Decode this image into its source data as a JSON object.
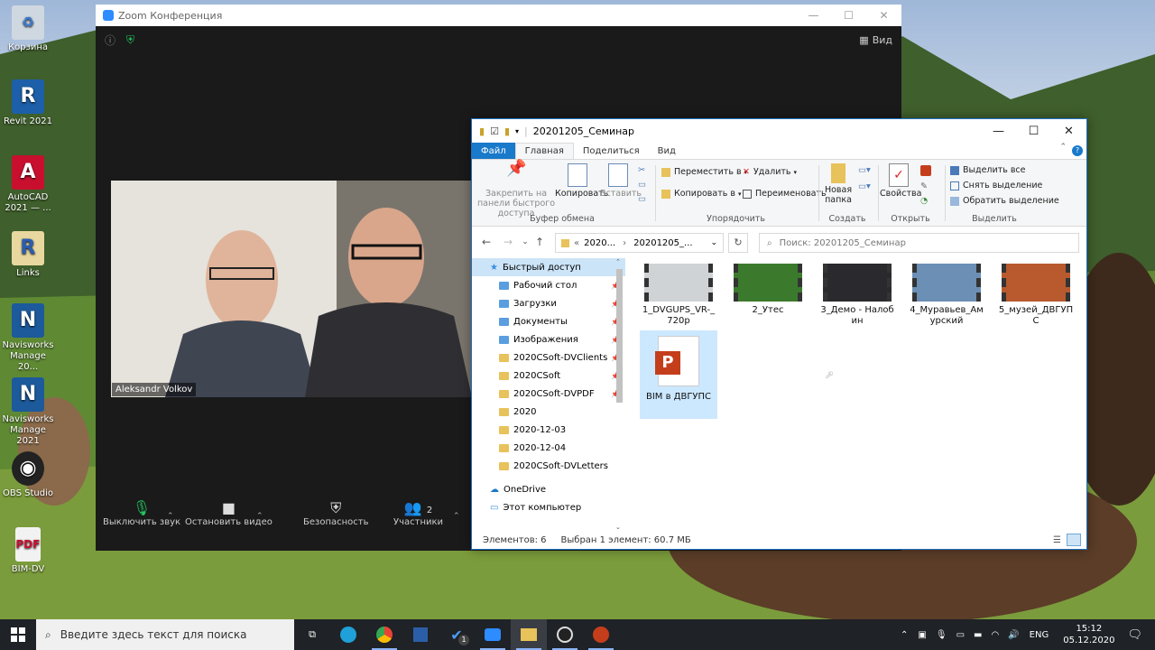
{
  "desktop": {
    "icons": [
      {
        "label": "Корзина",
        "icon": "recycle-bin-icon"
      },
      {
        "label": "Revit 2021",
        "icon": "revit-icon"
      },
      {
        "label": "AutoCAD 2021 — ...",
        "icon": "autocad-icon"
      },
      {
        "label": "Links",
        "icon": "links-icon"
      },
      {
        "label": "Navisworks Manage 20...",
        "icon": "navisworks-icon"
      },
      {
        "label": "Navisworks Manage 2021",
        "icon": "navisworks-icon"
      },
      {
        "label": "OBS Studio",
        "icon": "obs-icon"
      },
      {
        "label": "BIM-DV",
        "icon": "pdf-icon"
      }
    ]
  },
  "zoom": {
    "title": "Zoom Конференция",
    "view_label": "Вид",
    "participant_name": "Aleksandr Volkov",
    "controls": {
      "mute": "Выключить звук",
      "video": "Остановить видео",
      "security": "Безопасность",
      "participants": "Участники",
      "participants_count": "2"
    }
  },
  "explorer": {
    "title": "20201205_Семинар",
    "tabs": [
      "Файл",
      "Главная",
      "Поделиться",
      "Вид"
    ],
    "ribbon": {
      "pin": "Закрепить на панели быстрого доступа",
      "copy": "Копировать",
      "paste": "Вставить",
      "clipboard_group": "Буфер обмена",
      "move_to": "Переместить в",
      "copy_to": "Копировать в",
      "delete": "Удалить",
      "rename": "Переименовать",
      "organize_group": "Упорядочить",
      "new_folder": "Новая папка",
      "create_group": "Создать",
      "properties": "Свойства",
      "open_group": "Открыть",
      "select_all": "Выделить все",
      "select_none": "Снять выделение",
      "invert": "Обратить выделение",
      "select_group": "Выделить"
    },
    "address": {
      "crumb1": "2020...",
      "crumb2": "20201205_...",
      "prefix": "«"
    },
    "search_placeholder": "Поиск: 20201205_Семинар",
    "nav": [
      {
        "label": "Быстрый доступ",
        "pinned": false,
        "kind": "star"
      },
      {
        "label": "Рабочий стол",
        "pinned": true,
        "kind": "desktop"
      },
      {
        "label": "Загрузки",
        "pinned": true,
        "kind": "download"
      },
      {
        "label": "Документы",
        "pinned": true,
        "kind": "docs"
      },
      {
        "label": "Изображения",
        "pinned": true,
        "kind": "images"
      },
      {
        "label": "2020CSoft-DVClients",
        "pinned": true,
        "kind": "folder"
      },
      {
        "label": "2020CSoft",
        "pinned": true,
        "kind": "folder"
      },
      {
        "label": "2020CSoft-DVPDF",
        "pinned": true,
        "kind": "folder"
      },
      {
        "label": "2020",
        "pinned": false,
        "kind": "folder"
      },
      {
        "label": "2020-12-03",
        "pinned": false,
        "kind": "folder"
      },
      {
        "label": "2020-12-04",
        "pinned": false,
        "kind": "folder"
      },
      {
        "label": "2020CSoft-DVLetters",
        "pinned": false,
        "kind": "folder"
      },
      {
        "label": "OneDrive",
        "pinned": false,
        "kind": "cloud"
      },
      {
        "label": "Этот компьютер",
        "pinned": false,
        "kind": "pc"
      }
    ],
    "files": [
      {
        "name": "1_DVGUPS_VR-_720p",
        "type": "video",
        "color": "#cfd3d6"
      },
      {
        "name": "2_Утес",
        "type": "video",
        "color": "#3b7a2c"
      },
      {
        "name": "3_Демо - Налобин",
        "type": "video",
        "color": "#2a2a2e"
      },
      {
        "name": "4_Муравьев_Амурский",
        "type": "video",
        "color": "#6b8fb5"
      },
      {
        "name": "5_музей_ДВГУПС",
        "type": "video",
        "color": "#b85a2d"
      },
      {
        "name": "BIM в ДВГУПС",
        "type": "pptx",
        "color": "#c43e1c"
      }
    ],
    "status": {
      "count": "Элементов: 6",
      "selected": "Выбран 1 элемент: 60.7 МБ"
    }
  },
  "taskbar": {
    "search_placeholder": "Введите здесь текст для поиска",
    "language": "ENG",
    "time": "15:12",
    "date": "05.12.2020",
    "badge": "1"
  }
}
